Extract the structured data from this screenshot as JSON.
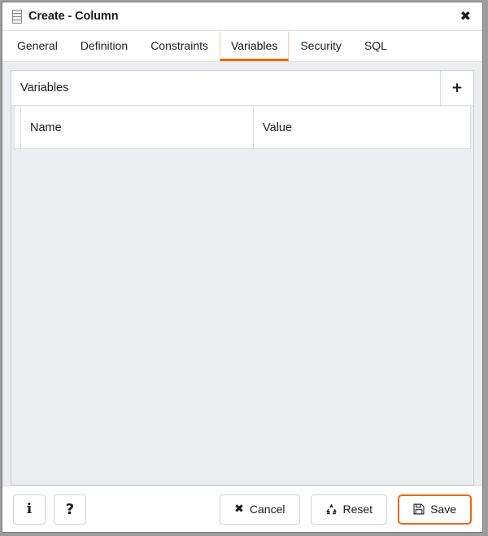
{
  "window": {
    "title": "Create - Column",
    "icon": "column-icon",
    "close_label": "✖"
  },
  "tabs": [
    {
      "label": "General",
      "active": false
    },
    {
      "label": "Definition",
      "active": false
    },
    {
      "label": "Constraints",
      "active": false
    },
    {
      "label": "Variables",
      "active": true
    },
    {
      "label": "Security",
      "active": false
    },
    {
      "label": "SQL",
      "active": false
    }
  ],
  "panel": {
    "title": "Variables",
    "add_label": "+",
    "columns": [
      "Name",
      "Value"
    ],
    "rows": []
  },
  "footer": {
    "info_label": "i",
    "help_label": "?",
    "cancel_label": "Cancel",
    "cancel_icon": "✖",
    "reset_label": "Reset",
    "save_label": "Save"
  },
  "colors": {
    "accent": "#e8690b",
    "accent_light": "#f7cdaa",
    "body_bg": "#ebedf0",
    "panel_bg": "#ffffff",
    "border": "#c9ccd1",
    "text": "#1b1b1b"
  }
}
